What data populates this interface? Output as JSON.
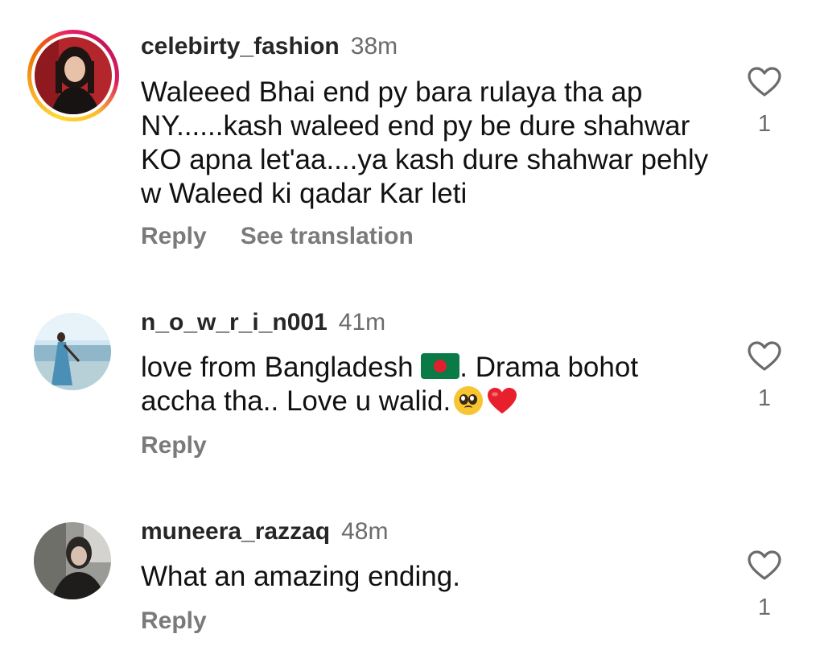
{
  "comments": [
    {
      "username": "celebirty_fashion",
      "time": "38m",
      "text": "Waleeed Bhai end py bara rulaya tha ap NY......kash waleed end py be dure shahwar KO apna let'aa....ya kash dure shahwar pehly w Waleed ki qadar Kar leti",
      "reply_label": "Reply",
      "translation_label": "See translation",
      "like_count": "1",
      "has_story_ring": true
    },
    {
      "username": "n_o_w_r_i_n001",
      "time": "41m",
      "text_part1": "love from Bangladesh ",
      "text_part2": ". Drama bohot accha tha.. Love u walid.",
      "reply_label": "Reply",
      "like_count": "1",
      "has_story_ring": false
    },
    {
      "username": "muneera_razzaq",
      "time": "48m",
      "text": "What an amazing ending.",
      "reply_label": "Reply",
      "like_count": "1",
      "has_story_ring": false
    }
  ],
  "icons": {
    "like": "heart-outline-icon",
    "flag": "bangladesh-flag-emoji",
    "plead": "pleading-face-emoji",
    "heart": "red-heart-emoji"
  },
  "colors": {
    "username": "#262626",
    "secondary_text": "#7a7a7a",
    "story_ring_start": "#fdd835",
    "story_ring_end": "#d81b60",
    "heart_emoji": "#e8202e"
  }
}
